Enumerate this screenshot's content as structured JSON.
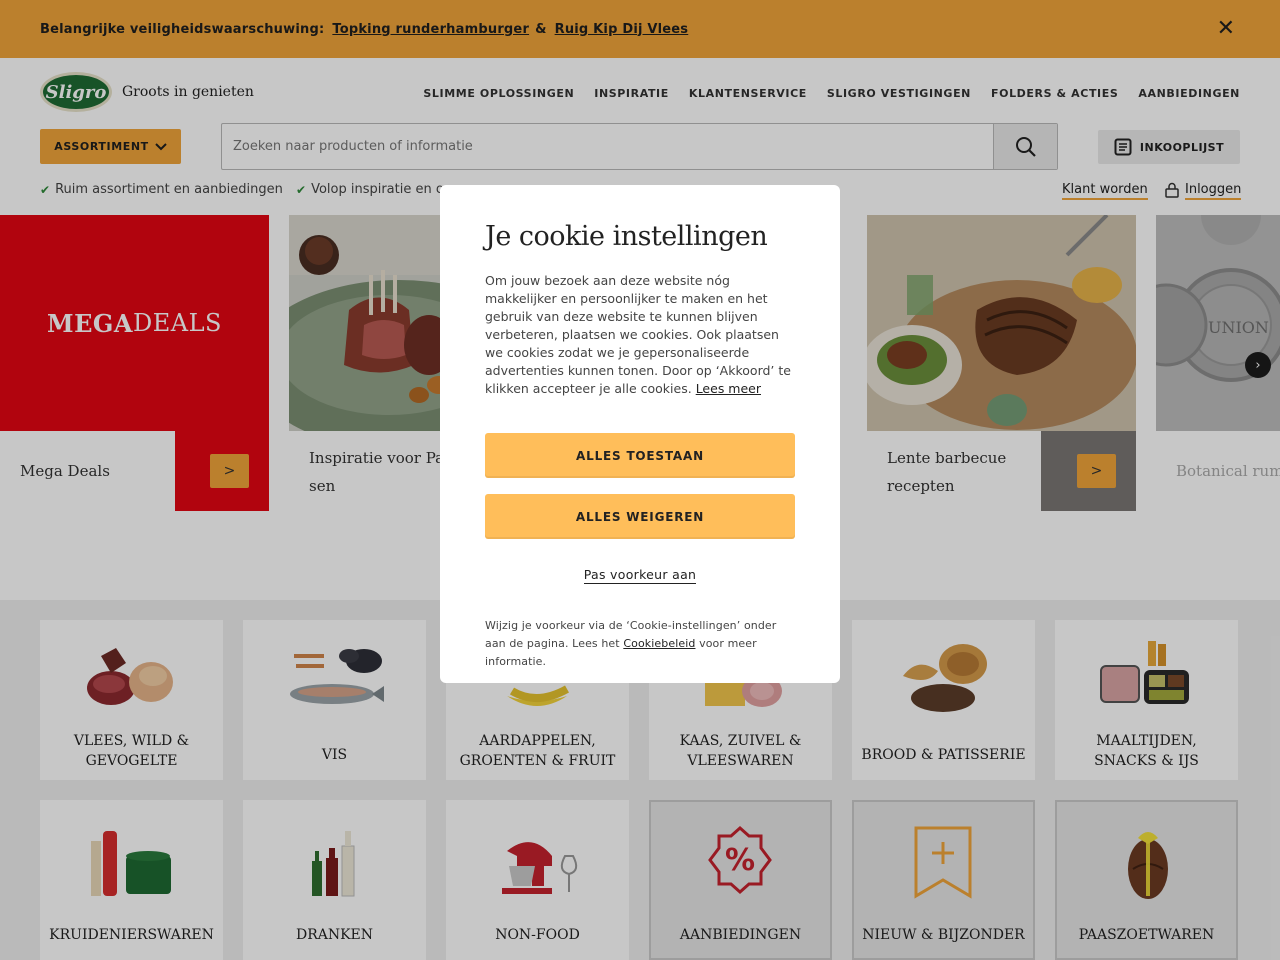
{
  "alert": {
    "prefix": "Belangrijke veiligheidswaarschuwing:",
    "link1": "Topking runderhamburger",
    "amp": "&",
    "link2": "Ruig Kip Dij Vlees",
    "close": "✕"
  },
  "header": {
    "logo_text": "Sligro",
    "tagline": "Groots in genieten",
    "nav": [
      "SLIMME OPLOSSINGEN",
      "INSPIRATIE",
      "KLANTENSERVICE",
      "SLIGRO VESTIGINGEN",
      "FOLDERS & ACTIES",
      "AANBIEDINGEN"
    ],
    "assortiment": "ASSORTIMENT",
    "search_placeholder": "Zoeken naar producten of informatie",
    "inkooplijst": "INKOOPLIJST",
    "usp1": "Ruim assortiment en aanbiedingen",
    "usp2": "Volop inspiratie en o",
    "klant_worden": "Klant worden",
    "inloggen": "Inloggen"
  },
  "carousel": {
    "mega_logo_a": "MEGA",
    "mega_logo_b": "DEALS",
    "cards": [
      {
        "caption": "Mega Deals"
      },
      {
        "caption": "Inspiratie voor Pa-\nsen"
      },
      {
        "caption": "Lente barbecue recepten"
      },
      {
        "caption": "Botanical rum"
      }
    ],
    "arrow": ">",
    "next": "›"
  },
  "categories": [
    {
      "label": "VLEES, WILD & GEVOGELTE",
      "icon": "meat-icon"
    },
    {
      "label": "VIS",
      "icon": "fish-icon"
    },
    {
      "label": "AARDAPPELEN, GROENTEN & FRUIT",
      "icon": "produce-icon"
    },
    {
      "label": "KAAS, ZUIVEL & VLEESWAREN",
      "icon": "cheese-icon"
    },
    {
      "label": "BROOD & PATISSERIE",
      "icon": "bread-icon"
    },
    {
      "label": "MAALTIJDEN, SNACKS & IJS",
      "icon": "meals-icon"
    },
    {
      "label": "KRUIDENIERSWAREN",
      "icon": "grocery-icon"
    },
    {
      "label": "DRANKEN",
      "icon": "drinks-icon"
    },
    {
      "label": "NON-FOOD",
      "icon": "mixer-icon"
    },
    {
      "label": "AANBIEDINGEN",
      "icon": "percent-badge-icon"
    },
    {
      "label": "NIEUW & BIJZONDER",
      "icon": "bookmark-plus-icon"
    },
    {
      "label": "PAASZOETWAREN",
      "icon": "easter-egg-icon"
    }
  ],
  "cookie": {
    "title": "Je cookie instellingen",
    "body": "Om jouw bezoek aan deze website nóg makkelijker en persoonlijker te maken en het gebruik van deze website te kunnen blijven verbeteren, plaatsen we cookies. Ook plaatsen we cookies zodat we je gepersonaliseerde advertenties kunnen tonen. Door op ‘Akkoord’ te klikken accepteer je alle cookies.",
    "lees_meer": "Lees meer",
    "accept_all": "ALLES TOESTAAN",
    "reject_all": "ALLES WEIGEREN",
    "prefs": "Pas voorkeur aan",
    "footer_a": "Wijzig je voorkeur via de ‘Cookie-instellingen’ onder aan de pagina. Lees het",
    "footer_link": "Cookiebeleid",
    "footer_b": "voor meer informatie."
  },
  "colors": {
    "accent": "#f0a43a",
    "button": "#ffbe5a",
    "mega_red": "#e30613",
    "brand_green": "#1e6b34"
  }
}
